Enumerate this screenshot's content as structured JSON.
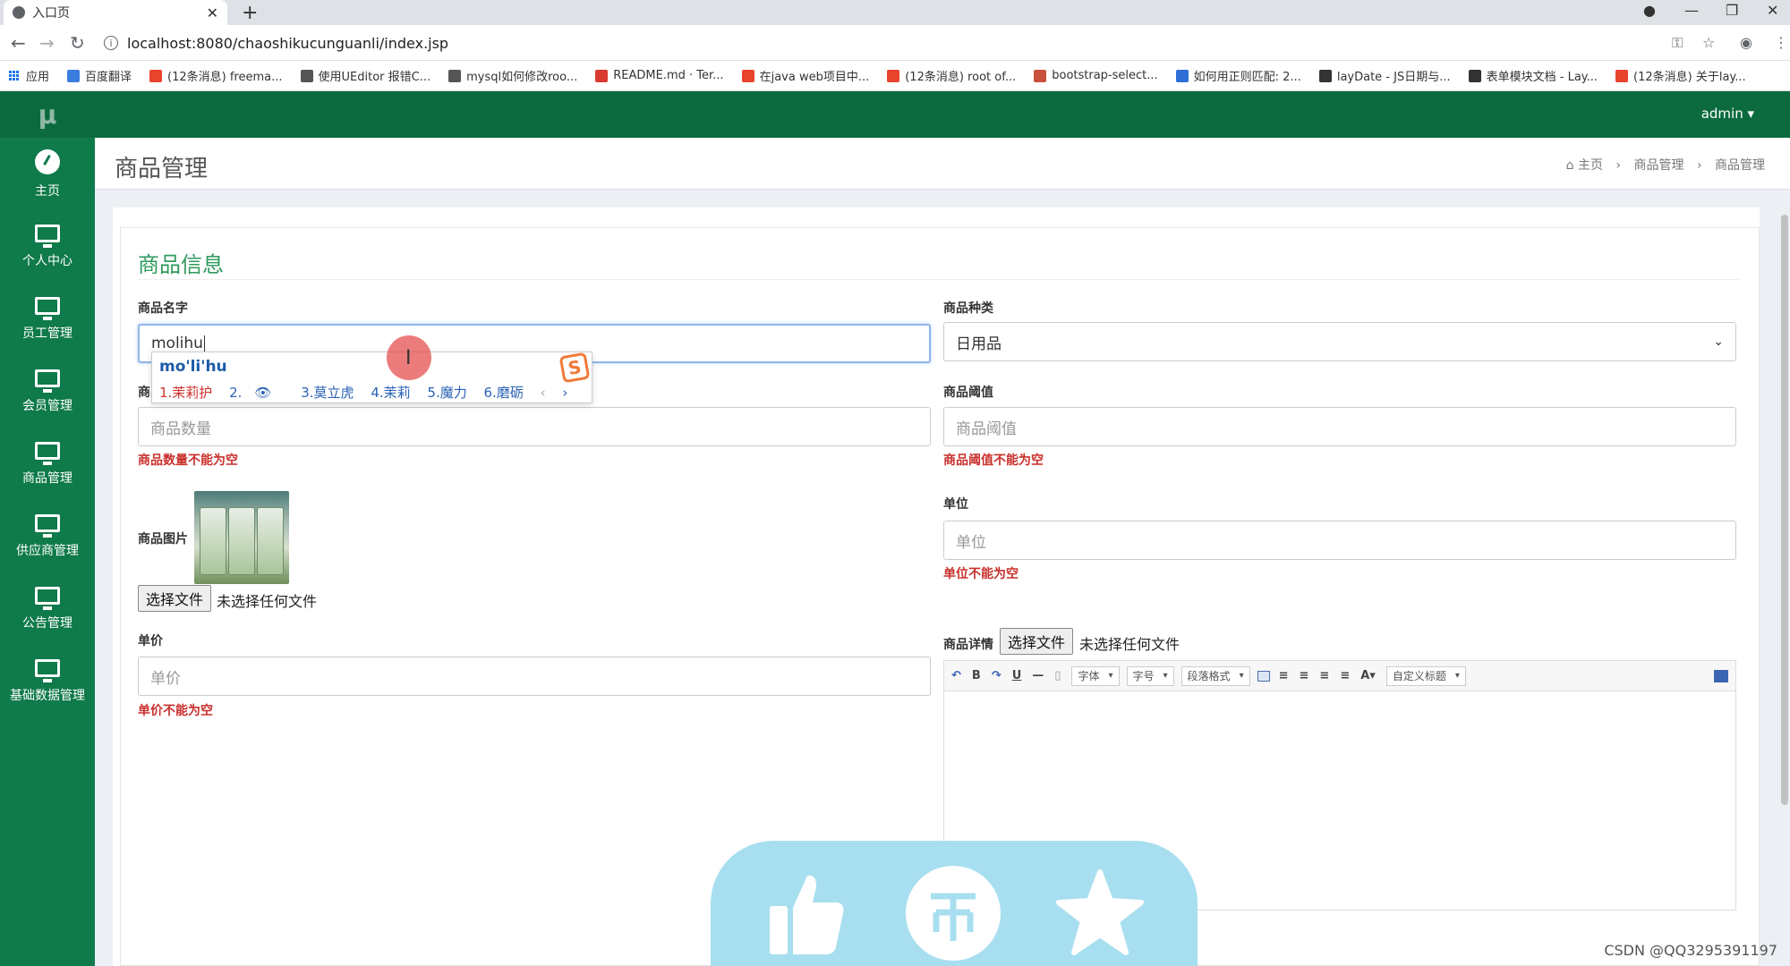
{
  "browser": {
    "tab_title": "入口页",
    "url": "localhost:8080/chaoshikucunguanli/index.jsp",
    "bookmarks": [
      {
        "label": "应用",
        "color": "#1a73e8"
      },
      {
        "label": "百度翻译",
        "color": "#3b7ddd"
      },
      {
        "label": "(12条消息) freema...",
        "color": "#e8432d"
      },
      {
        "label": "使用UEditor 报错C...",
        "color": "#555555"
      },
      {
        "label": "mysql如何修改roo...",
        "color": "#555555"
      },
      {
        "label": "README.md · Ter...",
        "color": "#d93a2f"
      },
      {
        "label": "在java web项目中...",
        "color": "#e8432d"
      },
      {
        "label": "(12条消息) root of...",
        "color": "#e8432d"
      },
      {
        "label": "bootstrap-select...",
        "color": "#c7513b"
      },
      {
        "label": "如何用正则匹配: 2...",
        "color": "#2f6fd6"
      },
      {
        "label": "layDate - JS日期与...",
        "color": "#333333"
      },
      {
        "label": "表单模块文档 - Lay...",
        "color": "#333333"
      },
      {
        "label": "(12条消息) 关于lay...",
        "color": "#e8432d"
      }
    ]
  },
  "sidebar": {
    "logo": "μ",
    "items": [
      {
        "label": "主页",
        "icon": "dashboard-icon"
      },
      {
        "label": "个人中心",
        "icon": "monitor-icon"
      },
      {
        "label": "员工管理",
        "icon": "monitor-icon"
      },
      {
        "label": "会员管理",
        "icon": "monitor-icon"
      },
      {
        "label": "商品管理",
        "icon": "monitor-icon"
      },
      {
        "label": "供应商管理",
        "icon": "monitor-icon"
      },
      {
        "label": "公告管理",
        "icon": "monitor-icon"
      },
      {
        "label": "基础数据管理",
        "icon": "monitor-icon"
      }
    ]
  },
  "topnav": {
    "user": "admin ▾"
  },
  "header": {
    "title": "商品管理",
    "breadcrumb": [
      "主页",
      "商品管理",
      "商品管理"
    ]
  },
  "form": {
    "section_title": "商品信息",
    "name": {
      "label": "商品名字",
      "value": "molihu"
    },
    "category": {
      "label": "商品种类",
      "value": "日用品"
    },
    "quantity": {
      "label": "商品数量",
      "placeholder": "商品数量",
      "error": "商品数量不能为空"
    },
    "threshold": {
      "label": "商品阈值",
      "placeholder": "商品阈值",
      "error": "商品阈值不能为空"
    },
    "image": {
      "label": "商品图片",
      "button": "选择文件",
      "status": "未选择任何文件"
    },
    "unit": {
      "label": "单位",
      "placeholder": "单位",
      "error": "单位不能为空"
    },
    "price": {
      "label": "单价",
      "placeholder": "单价",
      "error": "单价不能为空"
    },
    "details": {
      "label": "商品详情",
      "button": "选择文件",
      "status": "未选择任何文件"
    }
  },
  "editor": {
    "font": "字体",
    "size": "字号",
    "paragraph": "段落格式",
    "custom_title": "自定义标题"
  },
  "ime": {
    "pinyin": "mo'li'hu",
    "candidates": [
      "1.茉莉护",
      "2.",
      "3.莫立虎",
      "4.茉莉",
      "5.魔力",
      "6.磨砺"
    ]
  },
  "watermark": "CSDN @QQ3295391197"
}
